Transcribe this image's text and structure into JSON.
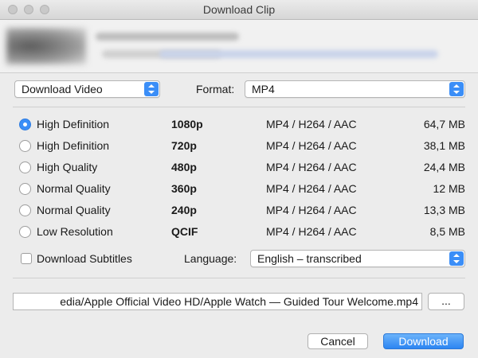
{
  "window": {
    "title": "Download Clip"
  },
  "options": {
    "download_type": "Download Video",
    "format_label": "Format:",
    "format_value": "MP4"
  },
  "qualities": [
    {
      "quality": "High Definition",
      "resolution": "1080p",
      "format": "MP4 / H264 / AAC",
      "size": "64,7 MB",
      "selected": true
    },
    {
      "quality": "High Definition",
      "resolution": "720p",
      "format": "MP4 / H264 / AAC",
      "size": "38,1 MB",
      "selected": false
    },
    {
      "quality": "High Quality",
      "resolution": "480p",
      "format": "MP4 / H264 / AAC",
      "size": "24,4 MB",
      "selected": false
    },
    {
      "quality": "Normal Quality",
      "resolution": "360p",
      "format": "MP4 / H264 / AAC",
      "size": "12 MB",
      "selected": false
    },
    {
      "quality": "Normal Quality",
      "resolution": "240p",
      "format": "MP4 / H264 / AAC",
      "size": "13,3 MB",
      "selected": false
    },
    {
      "quality": "Low Resolution",
      "resolution": "QCIF",
      "format": "MP4 / H264 / AAC",
      "size": "8,5 MB",
      "selected": false
    }
  ],
  "subtitles": {
    "checkbox_label": "Download Subtitles",
    "checked": false,
    "language_label": "Language:",
    "language_value": "English – transcribed"
  },
  "save_path": {
    "value": "edia/Apple Official Video HD/Apple Watch — Guided Tour  Welcome.mp4",
    "browse_label": "..."
  },
  "actions": {
    "cancel": "Cancel",
    "download": "Download"
  },
  "colors": {
    "accent": "#3b8ef7",
    "window_bg": "#ececec"
  }
}
